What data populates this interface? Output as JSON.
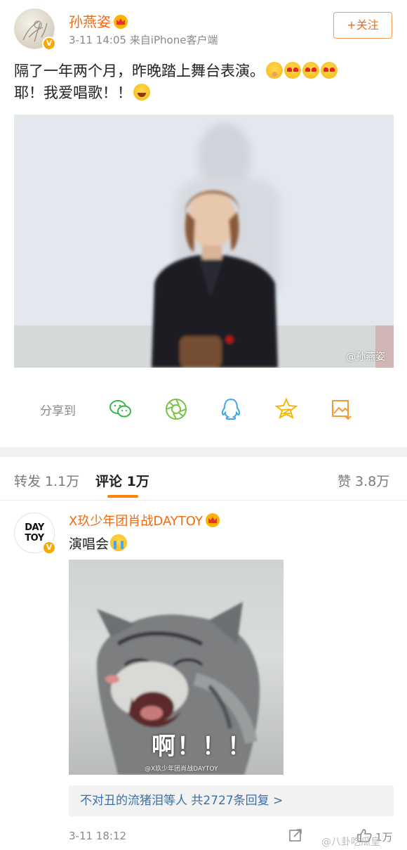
{
  "post": {
    "username": "孙燕姿",
    "meta": "3-11 14:05  来自iPhone客户端",
    "follow_label": "+关注",
    "verified_badge": "V",
    "text_line1": "隔了一年两个月，昨晚踏上舞台表演。",
    "text_line2": "耶！我爱唱歌！！",
    "photo_watermark": "@孙燕姿"
  },
  "share": {
    "label": "分享到",
    "targets": [
      "wechat-icon",
      "moments-icon",
      "qq-icon",
      "qzone-icon",
      "save-image-icon"
    ]
  },
  "tabs": {
    "repost": "转发 1.1万",
    "comments": "评论 1万",
    "likes": "赞 3.8万"
  },
  "comment": {
    "username": "X玖少年团肖战DAYTOY",
    "avatar_text_1": "DAY",
    "avatar_text_2": "TOY",
    "verified_badge": "V",
    "text": "演唱会",
    "image_caption": "啊！！！",
    "image_watermark": "@X玖少年团肖战DAYTOY",
    "replies_label": "不对丑的流猪泪等人 共2727条回复 >",
    "time": "3-11 18:12",
    "like_count": "1万"
  },
  "page_watermark": "@八卦吃瓜皇",
  "colors": {
    "accent": "#f26b10",
    "tab_indicator": "#ff8200",
    "link": "#3d6fa8"
  }
}
